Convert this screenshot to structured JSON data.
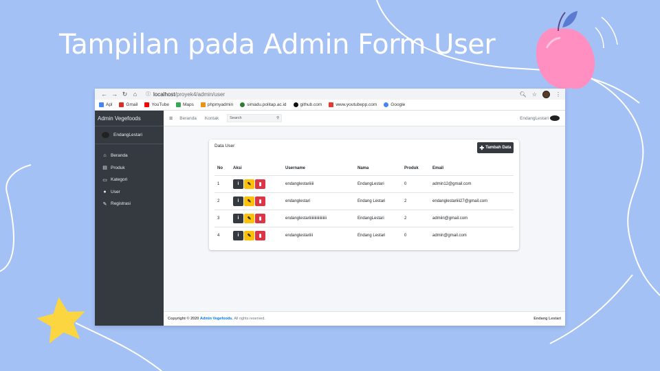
{
  "slide": {
    "title": "Tampilan pada Admin Form User"
  },
  "colors": {
    "background": "#a4c1f6",
    "sidebar": "#343a40",
    "edit_button": "#ffc107",
    "delete_button": "#dc3545",
    "link": "#007bff"
  },
  "browser": {
    "url_host": "localhost",
    "url_path": "/proyek4/admin/user",
    "bookmarks": [
      {
        "label": "Apl",
        "icon": "apps-grid-icon",
        "color": "#4285f4"
      },
      {
        "label": "Gmail",
        "icon": "gmail-icon",
        "color": "#d93025"
      },
      {
        "label": "YouTube",
        "icon": "youtube-icon",
        "color": "#ff0000"
      },
      {
        "label": "Maps",
        "icon": "maps-pin-icon",
        "color": "#34a853"
      },
      {
        "label": "phpmyadmin",
        "icon": "phpmyadmin-icon",
        "color": "#f29111"
      },
      {
        "label": "simadu.politap.ac.id",
        "icon": "simadu-icon",
        "color": "#2e7d32"
      },
      {
        "label": "github.com",
        "icon": "github-icon",
        "color": "#111111"
      },
      {
        "label": "www.youtubepp.com",
        "icon": "youtubepp-icon",
        "color": "#e53935"
      },
      {
        "label": "Google",
        "icon": "google-icon",
        "color": "#4285f4"
      }
    ]
  },
  "sidebar": {
    "brand": "Admin Vegefoods",
    "user": "EndangLestari",
    "items": [
      {
        "label": "Beranda",
        "icon": "home-icon"
      },
      {
        "label": "Produk",
        "icon": "list-icon"
      },
      {
        "label": "Kategori",
        "icon": "image-icon"
      },
      {
        "label": "User",
        "icon": "user-icon"
      },
      {
        "label": "Registrasi",
        "icon": "edit-icon"
      }
    ]
  },
  "topnav": {
    "links": [
      "Beranda",
      "Kontak"
    ],
    "search_placeholder": "Search",
    "user": "EndangLestari"
  },
  "card": {
    "title": "Data User",
    "add_button": "Tambah Data",
    "columns": [
      "No",
      "Aksi",
      "Username",
      "Nama",
      "Produk",
      "Email"
    ],
    "rows": [
      {
        "no": "1",
        "username": "endanglestariiiii",
        "nama": "EndangLestari",
        "produk": "0",
        "email": "admin12@gmail.com"
      },
      {
        "no": "2",
        "username": "endanglestari",
        "nama": "Endang Lestari",
        "produk": "2",
        "email": "endanglestariiii27@gmail.com"
      },
      {
        "no": "3",
        "username": "endanglestariiiiiiiiiiiiiiiiiii",
        "nama": "EndangLestari",
        "produk": "2",
        "email": "admiin@gmail.com"
      },
      {
        "no": "4",
        "username": "endanglestariiii",
        "nama": "Endang Lestari",
        "produk": "0",
        "email": "admin@gmail.com"
      }
    ]
  },
  "footer": {
    "copyright": "Copyright © 2020",
    "brand": "Admin Vegefoods.",
    "rights": "All rights reserved.",
    "author": "Endang Lestari"
  }
}
